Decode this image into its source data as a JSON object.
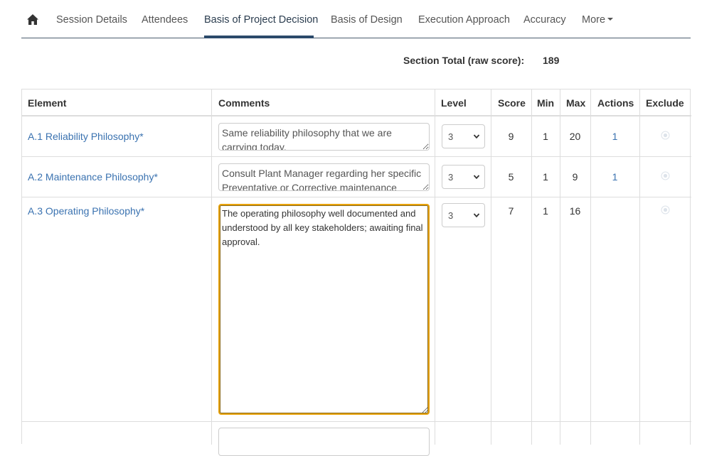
{
  "nav": {
    "home_icon": "home-icon",
    "tabs": [
      {
        "label": "Session Details"
      },
      {
        "label": "Attendees"
      },
      {
        "label": "Basis of Project Decision",
        "active": true
      },
      {
        "label": "Basis of Design"
      },
      {
        "label": "Execution Approach"
      },
      {
        "label": "Accuracy"
      },
      {
        "label": "More"
      }
    ]
  },
  "section_total": {
    "label": "Section Total (raw score):",
    "value": "189"
  },
  "table": {
    "headers": {
      "element": "Element",
      "comments": "Comments",
      "level": "Level",
      "score": "Score",
      "min": "Min",
      "max": "Max",
      "actions": "Actions",
      "exclude": "Exclude"
    },
    "rows": [
      {
        "element": "A.1 Reliability Philosophy*",
        "comment": "Same reliability philosophy that we are carrying today.",
        "level": "3",
        "score": "9",
        "min": "1",
        "max": "20",
        "actions": "1"
      },
      {
        "element": "A.2 Maintenance Philosophy*",
        "comment": "Consult Plant Manager regarding her specific Preventative or Corrective maintenance",
        "level": "3",
        "score": "5",
        "min": "1",
        "max": "9",
        "actions": "1"
      },
      {
        "element": "A.3 Operating Philosophy*",
        "comment": "The operating philosophy well documented and understood by all key stakeholders; awaiting final approval.",
        "level": "3",
        "score": "7",
        "min": "1",
        "max": "16",
        "actions": ""
      }
    ]
  },
  "colors": {
    "link": "#3a72b0",
    "focus_border": "#e8a30c",
    "nav_underline": "#2b4a6a"
  }
}
